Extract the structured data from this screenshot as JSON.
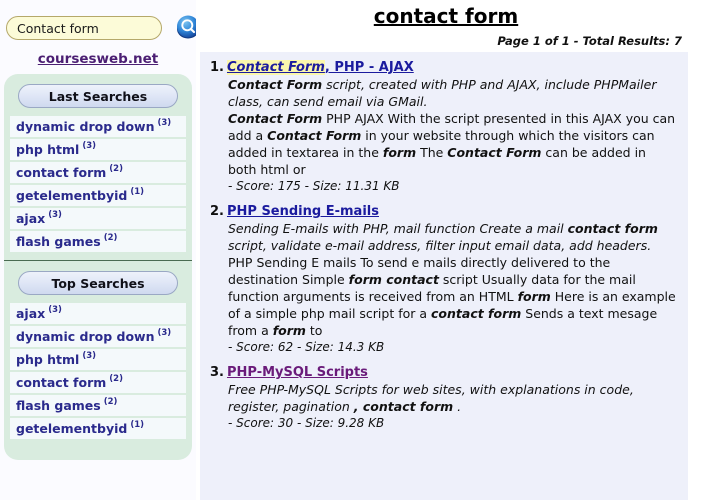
{
  "search": {
    "value": "Contact form",
    "placeholder": "Search",
    "button_icon": "search-icon"
  },
  "site": {
    "link_label": "coursesweb.net"
  },
  "sidebar": {
    "panels": [
      {
        "title": "Last Searches",
        "items": [
          {
            "keyword": "dynamic drop down",
            "count": "(3)"
          },
          {
            "keyword": "php html",
            "count": "(3)"
          },
          {
            "keyword": "contact form",
            "count": "(2)"
          },
          {
            "keyword": "getelementbyid",
            "count": "(1)"
          },
          {
            "keyword": "ajax",
            "count": "(3)"
          },
          {
            "keyword": "flash games",
            "count": "(2)"
          }
        ]
      },
      {
        "title": "Top Searches",
        "items": [
          {
            "keyword": "ajax",
            "count": "(3)"
          },
          {
            "keyword": "dynamic drop down",
            "count": "(3)"
          },
          {
            "keyword": "php html",
            "count": "(3)"
          },
          {
            "keyword": "contact form",
            "count": "(2)"
          },
          {
            "keyword": "flash games",
            "count": "(2)"
          },
          {
            "keyword": "getelementbyid",
            "count": "(1)"
          }
        ]
      }
    ]
  },
  "main": {
    "title": "contact form",
    "page_info": "Page 1 of 1 - Total Results: 7",
    "results": [
      {
        "number": "1.",
        "title_highlight": "Contact Form",
        "title_rest": ", PHP - AJAX",
        "visited": false,
        "score_line": "- Score: 175 - Size: 11.31 KB"
      },
      {
        "number": "2.",
        "title_highlight": "",
        "title_rest": "PHP Sending E-mails",
        "visited": false,
        "score_line": "- Score: 62 - Size: 14.3 KB"
      },
      {
        "number": "3.",
        "title_highlight": "",
        "title_rest": "PHP-MySQL Scripts",
        "visited": true,
        "score_line": "- Score: 30 - Size: 9.28 KB"
      }
    ]
  },
  "colors": {
    "link": "#1b1b9e",
    "visited_link": "#6a1b7a",
    "highlight": "#fbf7ad",
    "panel_bg": "#d9ecdf",
    "results_bg": "#eef0fa",
    "search_bg": "#fcfbd8"
  }
}
